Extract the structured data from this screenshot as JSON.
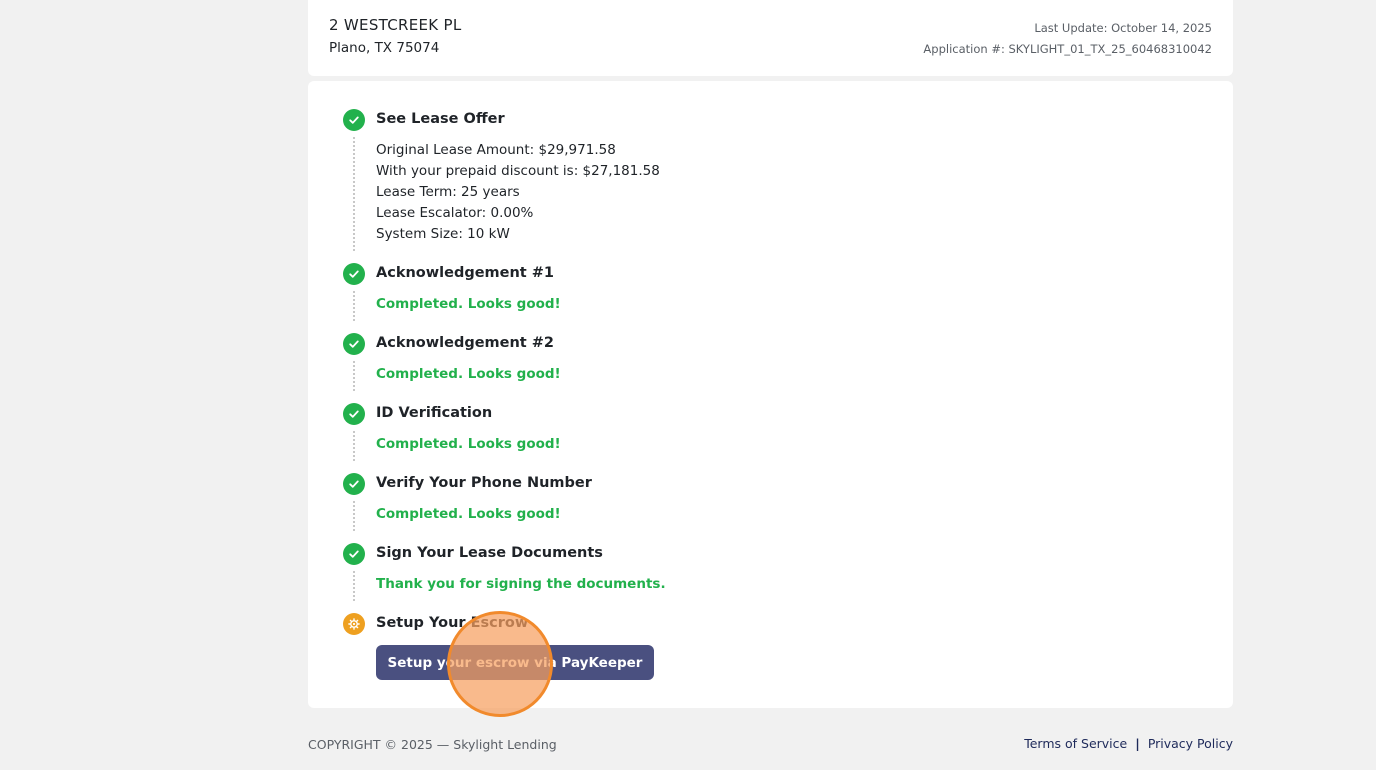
{
  "header": {
    "address_line1": "2 WESTCREEK PL",
    "address_line2": "Plano, TX 75074",
    "last_update": "Last Update: October 14, 2025",
    "application": "Application #: SKYLIGHT_01_TX_25_60468310042"
  },
  "steps": [
    {
      "title": "See Lease Offer",
      "status": "done",
      "details": [
        "Original Lease Amount: $29,971.58",
        "With your prepaid discount is: $27,181.58",
        "Lease Term: 25 years",
        "Lease Escalator: 0.00%",
        "System Size: 10 kW"
      ]
    },
    {
      "title": "Acknowledgement #1",
      "status": "done",
      "message": "Completed. Looks good!"
    },
    {
      "title": "Acknowledgement #2",
      "status": "done",
      "message": "Completed. Looks good!"
    },
    {
      "title": "ID Verification",
      "status": "done",
      "message": "Completed. Looks good!"
    },
    {
      "title": "Verify Your Phone Number",
      "status": "done",
      "message": "Completed. Looks good!"
    },
    {
      "title": "Sign Your Lease Documents",
      "status": "done",
      "message": "Thank you for signing the documents."
    },
    {
      "title": "Setup Your Escrow",
      "status": "pending",
      "button_label": "Setup your escrow via PayKeeper"
    }
  ],
  "footer": {
    "copyright": "COPYRIGHT © 2025 — Skylight Lending",
    "terms": "Terms of Service",
    "separator": "|",
    "privacy": "Privacy Policy"
  },
  "colors": {
    "done": "#22b14c",
    "pending": "#eea020",
    "button": "#4a5080",
    "link": "#1e2a5a"
  },
  "icons": {
    "done": "check-icon",
    "pending": "gear-icon"
  }
}
